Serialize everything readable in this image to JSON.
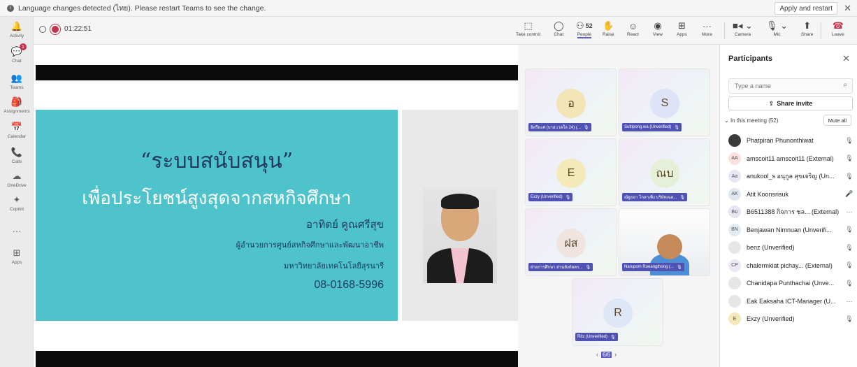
{
  "notification": {
    "message": "Language changes detected (ไทย). Please restart Teams to see the change.",
    "apply_label": "Apply and restart",
    "close_glyph": "✕"
  },
  "rail": {
    "items": [
      {
        "label": "Activity",
        "icon": "bell-icon",
        "glyph": "🔔"
      },
      {
        "label": "Chat",
        "icon": "chat-icon",
        "glyph": "💬",
        "badge": "1"
      },
      {
        "label": "Teams",
        "icon": "teams-icon",
        "glyph": "👥"
      },
      {
        "label": "Assignments",
        "icon": "assignments-icon",
        "glyph": "🎒"
      },
      {
        "label": "Calendar",
        "icon": "calendar-icon",
        "glyph": "📅"
      },
      {
        "label": "Calls",
        "icon": "phone-icon",
        "glyph": "📞"
      },
      {
        "label": "OneDrive",
        "icon": "cloud-icon",
        "glyph": "☁"
      },
      {
        "label": "Copilot",
        "icon": "copilot-icon",
        "glyph": "✦"
      },
      {
        "label": "",
        "icon": "more-icon",
        "glyph": "···"
      },
      {
        "label": "Apps",
        "icon": "apps-icon",
        "glyph": "⊞"
      }
    ]
  },
  "toolbar": {
    "timer": "01:22:51",
    "take_control": "Take control",
    "chat": "Chat",
    "people": "People",
    "people_count": "52",
    "raise": "Raise",
    "react": "React",
    "view": "View",
    "apps": "Apps",
    "more": "More",
    "camera": "Camera",
    "mic": "Mic",
    "share": "Share",
    "leave": "Leave"
  },
  "slide": {
    "title": "“ระบบสนับสนุน”",
    "subtitle": "เพื่อประโยชน์สูงสุดจากสหกิจศึกษา",
    "presenter": "อาทิตย์ คูณศรีสุข",
    "position": "ผู้อำนวยการศูนย์สหกิจศึกษาและพัฒนาอาชีพ",
    "university": "มหาวิทยาลัยเทคโนโลยีสุรนารี",
    "phone": "08-0168-5996"
  },
  "gallery": {
    "tiles": [
      {
        "initials": "อ",
        "name": "อิสรียะศ (บาส.เวลใล 24) (...",
        "avatar_color": "#f4e3b5"
      },
      {
        "initials": "S",
        "name": "Suttipong.wa (Unverified)",
        "avatar_color": "#dfe3f7"
      },
      {
        "initials": "E",
        "name": "Exzy (Unverified)",
        "avatar_color": "#f6e9b9"
      },
      {
        "initials": "ณบ",
        "name": "ณัฐธยา โกลาเพิ่ง บริษัทเฉล...",
        "avatar_color": "#e6f0d8"
      },
      {
        "initials": "ฝส",
        "name": "ฝ่ายการศึกษา ส่วนสังกัดคร...",
        "avatar_color": "#efe4e0"
      },
      {
        "initials": "",
        "name": "Narupom Rueangthong (...",
        "avatar_color": "#ffffff"
      },
      {
        "initials": "R",
        "name": "Ritz (Unverified)",
        "avatar_color": "#dfe6f6"
      }
    ],
    "page": "6/6"
  },
  "participants": {
    "title": "Participants",
    "search_placeholder": "Type a name",
    "share_invite": "Share invite",
    "section_label": "In this meeting (52)",
    "mute_all": "Mute all",
    "list": [
      {
        "initials": "",
        "name": "Phatpiran Phunonthiwat",
        "status": "mic-off",
        "color": "#3a3a3a"
      },
      {
        "initials": "AA",
        "name": "amscoit11 amscoit11 (External)",
        "status": "mic-off",
        "color": "#fde0e0"
      },
      {
        "initials": "Aa",
        "name": "anukool_s อนุกูล สุขเจริญ (Un...",
        "status": "mic-off",
        "color": "#e6e8f5"
      },
      {
        "initials": "AK",
        "name": "Atit Koonsrisuk",
        "status": "mic-on",
        "color": "#e0e7f0"
      },
      {
        "initials": "Bม",
        "name": "B6511388 กิจการ ชล... (External)",
        "status": "more",
        "color": "#e8e4f3"
      },
      {
        "initials": "BN",
        "name": "Benjawan Nimnuan (Unverifi...",
        "status": "mic-off",
        "color": "#e2ecf4"
      },
      {
        "initials": "",
        "name": "benz (Unverified)",
        "status": "mic-off",
        "color": "#e6e6e6"
      },
      {
        "initials": "CP",
        "name": "chalermkiat pichay... (External)",
        "status": "mic-off",
        "color": "#ece6f5"
      },
      {
        "initials": "",
        "name": "Chanidapa Punthachai (Unve...",
        "status": "mic-off",
        "color": "#e6e6e6"
      },
      {
        "initials": "",
        "name": "Eak Eaksaha ICT-Manager (U...",
        "status": "more",
        "color": "#e6e6e6"
      },
      {
        "initials": "E",
        "name": "Exzy (Unverified)",
        "status": "mic-off",
        "color": "#f6e9b9"
      }
    ]
  }
}
